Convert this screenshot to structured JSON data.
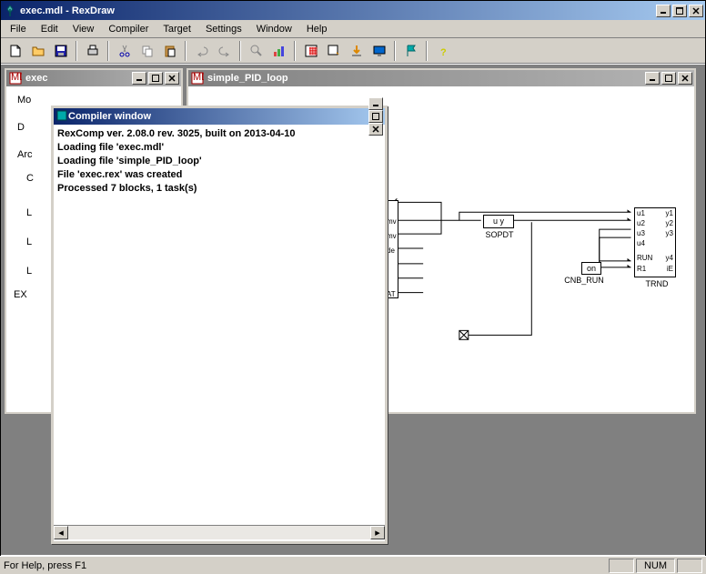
{
  "app": {
    "title": "exec.mdl - RexDraw"
  },
  "menu": {
    "file": "File",
    "edit": "Edit",
    "view": "View",
    "compiler": "Compiler",
    "target": "Target",
    "settings": "Settings",
    "window": "Window",
    "help": "Help"
  },
  "child_windows": {
    "exec": {
      "title": "exec"
    },
    "pid": {
      "title": "simple_PID_loop"
    }
  },
  "tree": {
    "mo": "Mo",
    "d": "D",
    "arc": "Arc",
    "c": "C",
    "l1": "L",
    "l2": "L",
    "l3": "L",
    "ex": "EX"
  },
  "compiler": {
    "title": "Compiler window",
    "lines": [
      "RexComp ver. 2.08.0 rev. 3025, built on 2013-04-10",
      "Loading file 'exec.mdl'",
      "Loading file 'simple_PID_loop'",
      "File 'exec.rex' was created",
      " Processed 7 blocks, 1 task(s)"
    ]
  },
  "diagram": {
    "sopdt_block": "u   y",
    "sopdt_label": "SOPDT",
    "cnb_block": "on",
    "cnb_label": "CNB_RUN",
    "trnd_label": "TRND",
    "trnd_ports_left": [
      "u1",
      "u2",
      "u3",
      "u4",
      "RUN",
      "R1"
    ],
    "trnd_ports_right": [
      "y1",
      "y2",
      "y3",
      "y4",
      "iE"
    ],
    "mv_label": "mv",
    "dmv_label": "mv",
    "de_label": "de",
    "sat_label": "AT"
  },
  "statusbar": {
    "help": "For Help, press F1",
    "num": "NUM"
  }
}
